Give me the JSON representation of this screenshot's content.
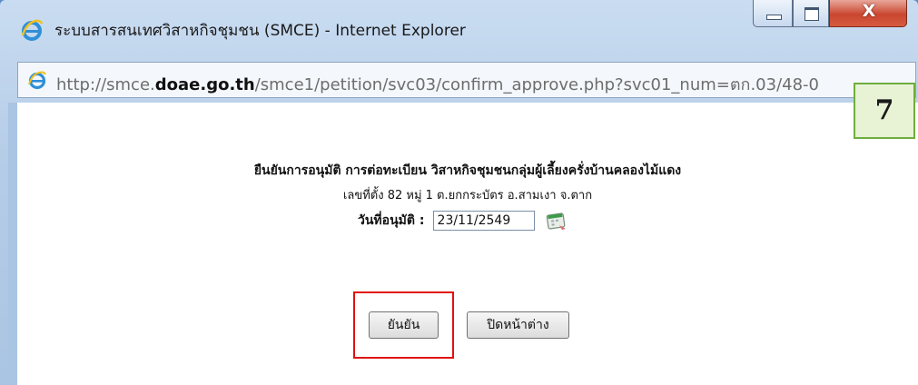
{
  "window": {
    "title": "ระบบสารสนเทศวิสาหกิจชุมชน (SMCE) - Internet Explorer",
    "close_glyph": "X",
    "accent": "#c9462f"
  },
  "address_bar": {
    "url_prefix": "http://smce.",
    "url_domain": "doae.go.th",
    "url_path": "/smce1/petition/svc03/confirm_approve.php?svc01_num=ตก.03/48-0"
  },
  "badge": {
    "text": "7"
  },
  "dialog": {
    "heading": "ยืนยันการอนุมัติ การต่อทะเบียน วิสาหกิจชุมชนกลุ่มผู้เลี้ยงครั่งบ้านคลองไม้แดง",
    "address": "เลขที่ตั้ง 82 หมู่ 1 ต.ยกกระบัตร อ.สามเงา จ.ตาก",
    "date_label": "วันที่อนุมัติ :",
    "date_value": "23/11/2549",
    "confirm_label": "ยันยัน",
    "close_label": "ปิดหน้าต่าง"
  },
  "icons": [
    "ie-logo-icon",
    "ie-page-icon",
    "calendar-icon"
  ]
}
